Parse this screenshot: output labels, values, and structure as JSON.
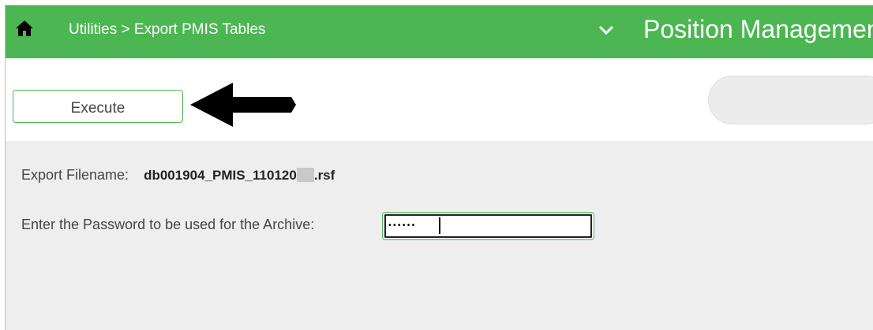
{
  "header": {
    "breadcrumb": "Utilities > Export PMIS Tables",
    "app_title": "Position Management",
    "home_icon": "home-icon",
    "chevron_icon": "chevron-down-icon",
    "background_color": "#4cb752"
  },
  "toolbar": {
    "execute_label": "Execute",
    "arrow_icon": "arrow-left-icon"
  },
  "form": {
    "filename_label": "Export Filename:",
    "filename_value": "db001904_PMIS_110120",
    "filename_ext": ".rsf",
    "password_label": "Enter the Password to be used for the Archive:",
    "password_value": "••••••"
  }
}
